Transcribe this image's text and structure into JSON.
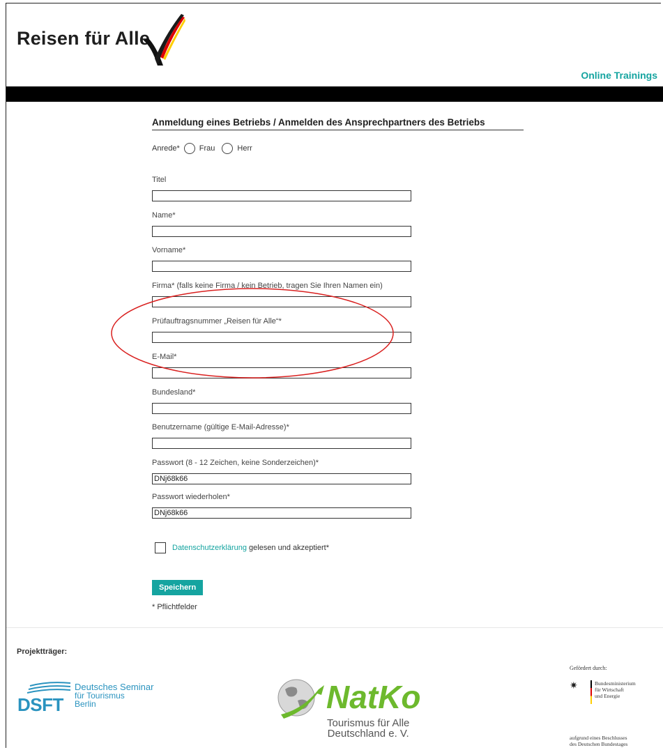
{
  "brand": {
    "logo_text": "Reisen für Alle",
    "nav_link": "Online Trainings"
  },
  "form": {
    "heading": "Anmeldung eines Betriebs / Anmelden des Ansprechpartners des Betriebs",
    "anrede_label": "Anrede*",
    "anrede_options": [
      "Frau",
      "Herr"
    ],
    "fields": [
      {
        "label": "Titel",
        "value": ""
      },
      {
        "label": "Name*",
        "value": ""
      },
      {
        "label": "Vorname*",
        "value": ""
      },
      {
        "label": "Firma* (falls keine Firma / kein Betrieb, tragen Sie Ihren Namen ein)",
        "value": ""
      },
      {
        "label": "Prüfauftragsnummer „Reisen für Alle“*",
        "value": ""
      },
      {
        "label": "E-Mail*",
        "value": ""
      },
      {
        "label": "Bundesland*",
        "value": ""
      },
      {
        "label": "Benutzername (gültige E-Mail-Adresse)*",
        "value": ""
      },
      {
        "label": "Passwort (8 - 12 Zeichen, keine Sonderzeichen)*",
        "value": "DNj68k66"
      },
      {
        "label": "Passwort wiederholen*",
        "value": "DNj68k66"
      }
    ],
    "consent_link": "Datenschutzerklärung",
    "consent_text": "gelesen und akzeptiert*",
    "save_label": "Speichern",
    "required_note": "* Pflichtfelder"
  },
  "footer": {
    "projekttraeger_label": "Projektträger:",
    "dsft": {
      "abbr": "DSFT",
      "line1": "Deutsches Seminar",
      "line2": "für Tourismus",
      "line3": "Berlin"
    },
    "natko": {
      "name": "NatKo",
      "line1": "Tourismus für Alle",
      "line2": "Deutschland e. V."
    },
    "foerder": {
      "label": "Gefördert durch:",
      "ministry_line1": "Bundesministerium",
      "ministry_line2": "für Wirtschaft",
      "ministry_line3": "und Energie",
      "beschluss_line1": "aufgrund eines Beschlusses",
      "beschluss_line2": "des Deutschen Bundestages"
    }
  },
  "colors": {
    "accent": "#15a4a0",
    "annotation": "#d9201f"
  }
}
